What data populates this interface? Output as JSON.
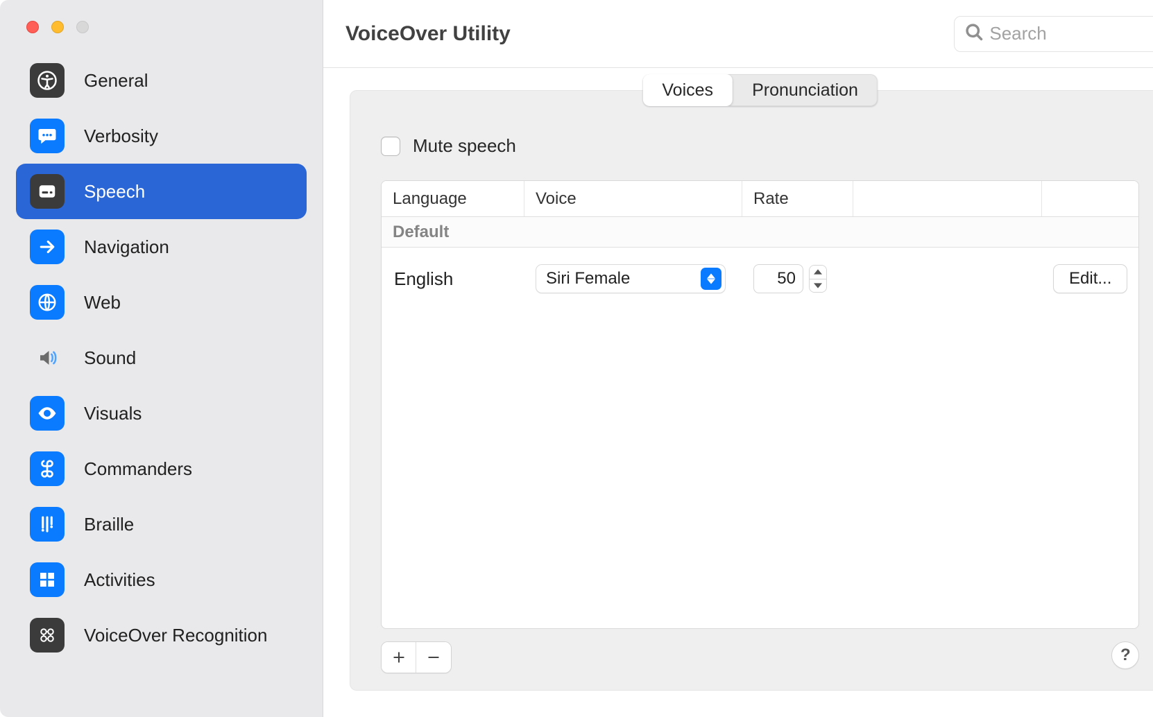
{
  "app_title": "VoiceOver Utility",
  "search": {
    "placeholder": "Search"
  },
  "sidebar": {
    "items": [
      {
        "label": "General",
        "icon": "accessibility-icon",
        "bg": "black"
      },
      {
        "label": "Verbosity",
        "icon": "speech-bubble-icon",
        "bg": "blue"
      },
      {
        "label": "Speech",
        "icon": "caption-icon",
        "bg": "black",
        "selected": true
      },
      {
        "label": "Navigation",
        "icon": "arrow-right-square-icon",
        "bg": "blue"
      },
      {
        "label": "Web",
        "icon": "globe-icon",
        "bg": "blue"
      },
      {
        "label": "Sound",
        "icon": "speaker-icon",
        "bg": "custom"
      },
      {
        "label": "Visuals",
        "icon": "eye-icon",
        "bg": "blue"
      },
      {
        "label": "Commanders",
        "icon": "command-icon",
        "bg": "blue"
      },
      {
        "label": "Braille",
        "icon": "braille-icon",
        "bg": "blue"
      },
      {
        "label": "Activities",
        "icon": "grid-icon",
        "bg": "blue"
      },
      {
        "label": "VoiceOver Recognition",
        "icon": "recognition-icon",
        "bg": "black"
      }
    ]
  },
  "tabs": {
    "items": [
      {
        "label": "Voices",
        "active": true
      },
      {
        "label": "Pronunciation",
        "active": false
      }
    ]
  },
  "mute_speech": {
    "label": "Mute speech",
    "checked": false
  },
  "table": {
    "headers": {
      "language": "Language",
      "voice": "Voice",
      "rate": "Rate"
    },
    "group_label": "Default",
    "row": {
      "language": "English",
      "voice": "Siri Female",
      "rate": "50",
      "edit_label": "Edit..."
    }
  }
}
